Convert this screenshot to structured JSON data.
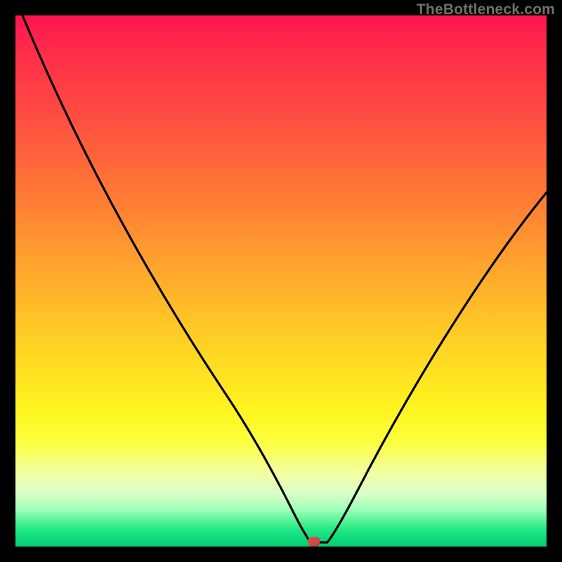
{
  "watermark": "TheBottleneck.com",
  "chart_data": {
    "type": "line",
    "title": "",
    "xlabel": "",
    "ylabel": "",
    "xlim": [
      0,
      100
    ],
    "ylim": [
      0,
      100
    ],
    "grid": false,
    "legend": false,
    "background_gradient": {
      "orientation": "vertical",
      "stops": [
        {
          "pos": 0,
          "color": "#ff1450",
          "meaning": "high-bottleneck"
        },
        {
          "pos": 50,
          "color": "#ffb028"
        },
        {
          "pos": 75,
          "color": "#fff41f"
        },
        {
          "pos": 100,
          "color": "#06d074",
          "meaning": "no-bottleneck"
        }
      ]
    },
    "series": [
      {
        "name": "bottleneck-curve",
        "color": "#000000",
        "x": [
          0,
          5,
          10,
          15,
          20,
          25,
          30,
          35,
          40,
          45,
          48,
          51,
          54,
          56,
          58,
          62,
          66,
          70,
          75,
          80,
          85,
          90,
          95,
          100
        ],
        "y": [
          100,
          94,
          87,
          80,
          72,
          64,
          55,
          46,
          36,
          24,
          15,
          7,
          2,
          0,
          0,
          4,
          11,
          19,
          30,
          41,
          51,
          59,
          66,
          71
        ]
      }
    ],
    "marker": {
      "x": 56,
      "y": 0,
      "color": "#d24a45",
      "shape": "pill"
    }
  }
}
